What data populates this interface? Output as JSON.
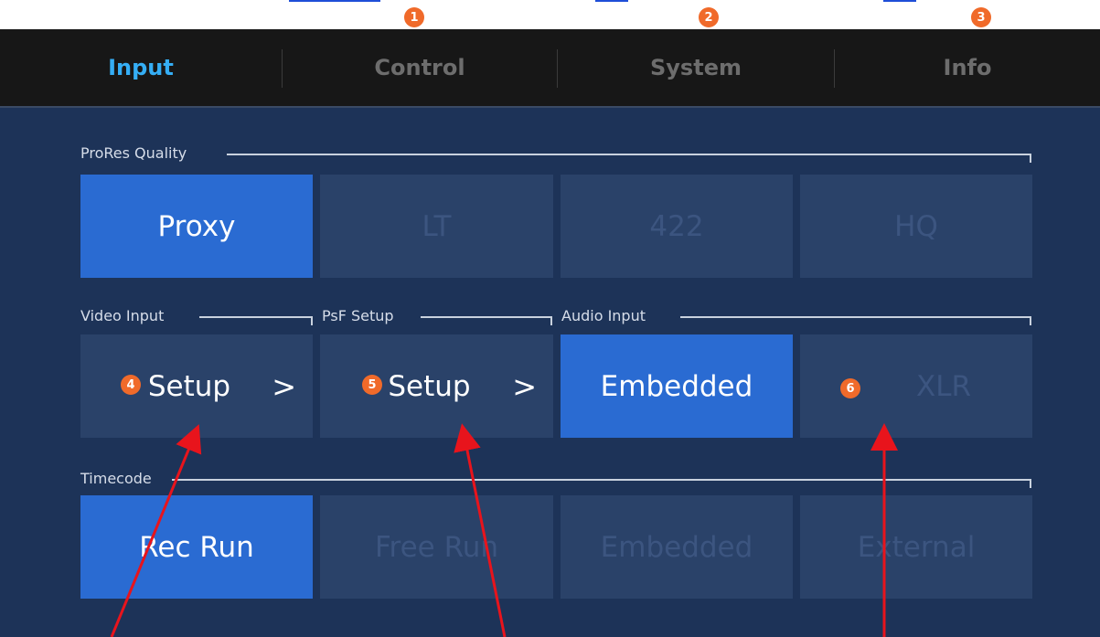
{
  "tabs": [
    {
      "label": "Input",
      "active": true
    },
    {
      "label": "Control",
      "active": false
    },
    {
      "label": "System",
      "active": false
    },
    {
      "label": "Info",
      "active": false
    }
  ],
  "callouts": [
    "1",
    "2",
    "3",
    "4",
    "5",
    "6"
  ],
  "prores": {
    "label": "ProRes Quality",
    "options": [
      "Proxy",
      "LT",
      "422",
      "HQ"
    ],
    "selected": "Proxy"
  },
  "video_input": {
    "label": "Video Input",
    "button": "Setup"
  },
  "psf_setup": {
    "label": "PsF Setup",
    "button": "Setup"
  },
  "audio_input": {
    "label": "Audio Input",
    "options": [
      "Embedded",
      "XLR"
    ],
    "selected": "Embedded"
  },
  "timecode": {
    "label": "Timecode",
    "options": [
      "Rec Run",
      "Free Run",
      "Embedded",
      "External"
    ],
    "selected": "Rec Run"
  },
  "colors": {
    "accent_tab": "#35aef5",
    "selected_button": "#2a6bd2",
    "panel": "#1d3358",
    "callout": "#f06a2a",
    "arrow": "#e8141c"
  }
}
